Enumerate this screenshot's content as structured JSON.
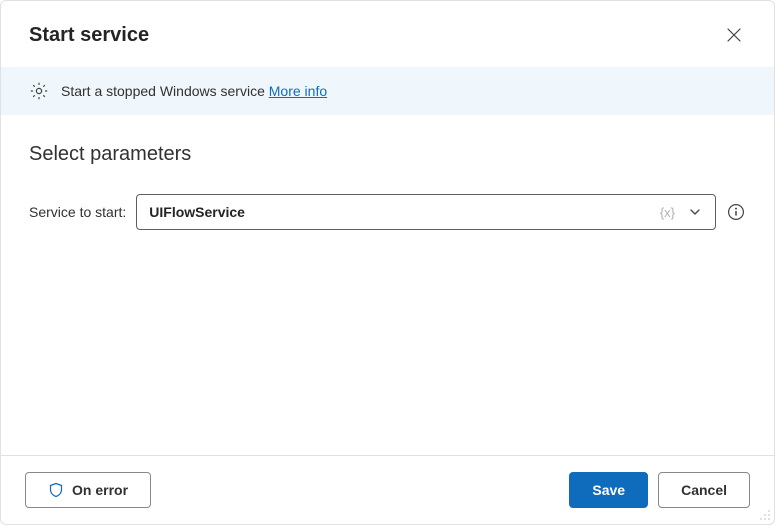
{
  "header": {
    "title": "Start service"
  },
  "info": {
    "text": "Start a stopped Windows service",
    "link_label": "More info"
  },
  "section": {
    "title": "Select parameters"
  },
  "param": {
    "label": "Service to start:",
    "value": "UIFlowService",
    "variable_token": "{x}"
  },
  "footer": {
    "on_error_label": "On error",
    "save_label": "Save",
    "cancel_label": "Cancel"
  }
}
